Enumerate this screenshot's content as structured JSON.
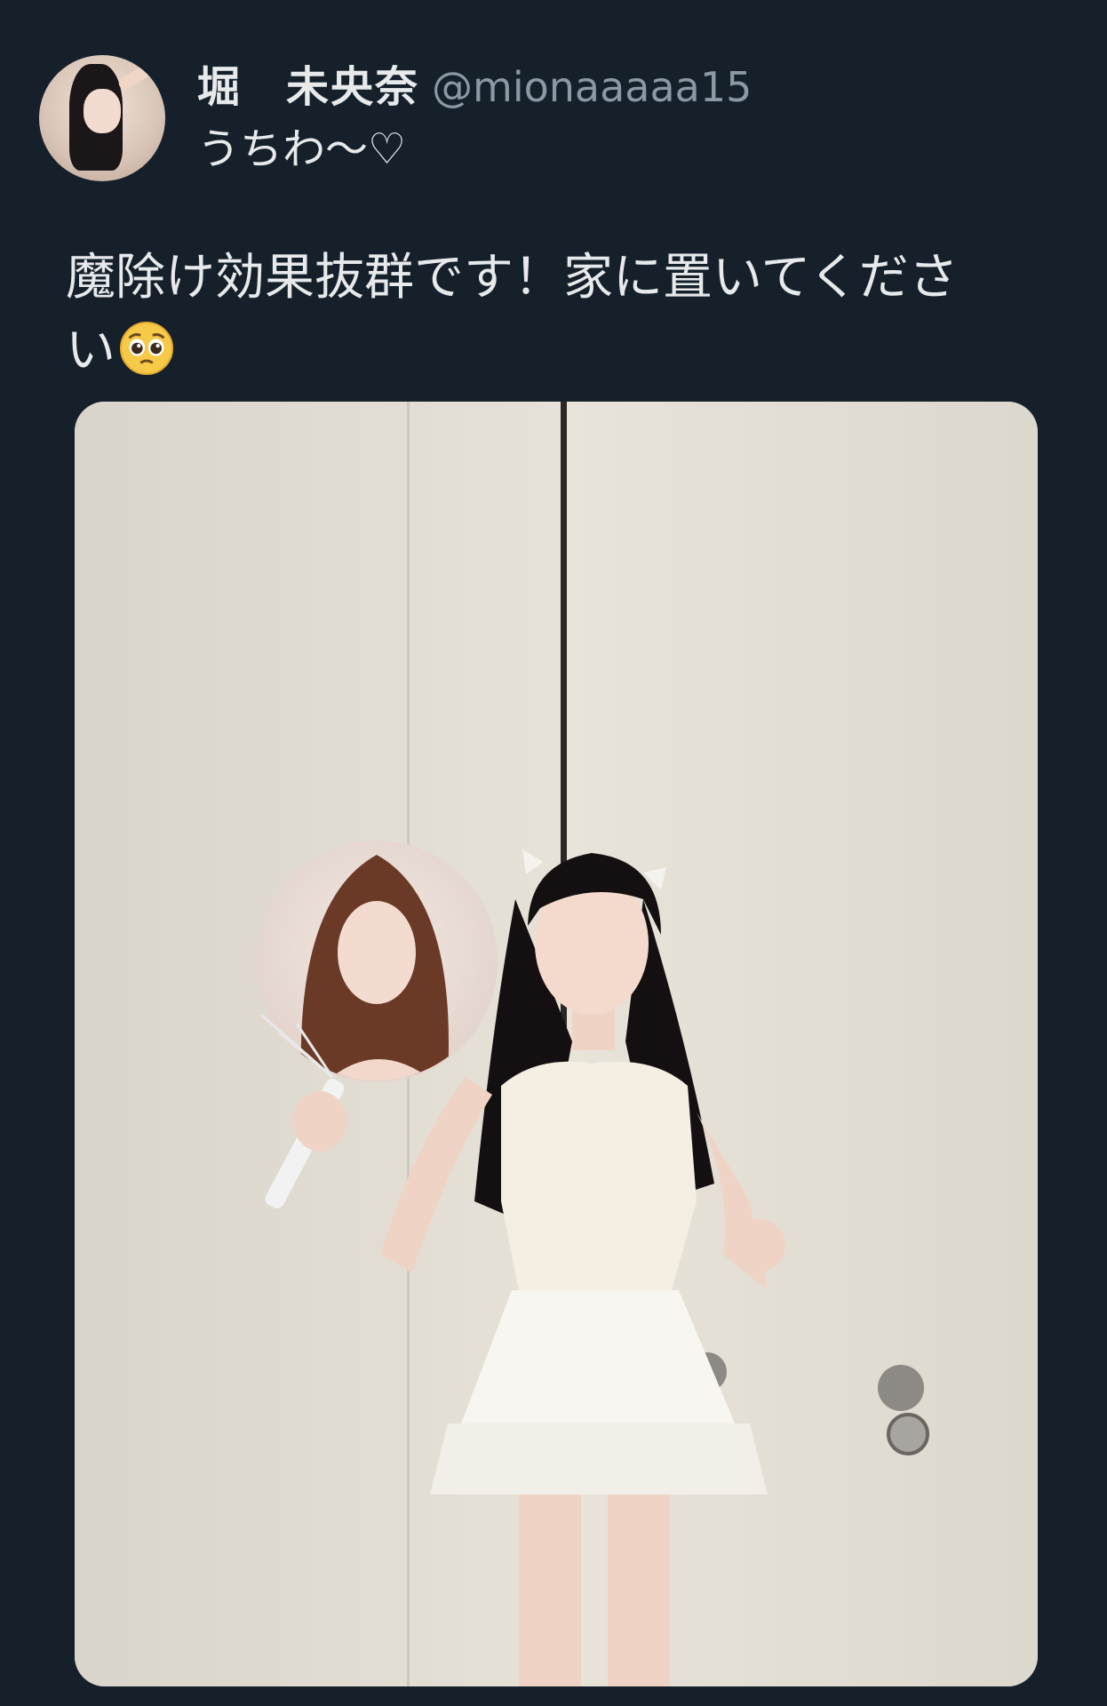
{
  "tweet": {
    "display_name": "堀　未央奈",
    "handle": "@mionaaaaa15",
    "subtitle": "うちわ〜♡",
    "body_line_1": "魔除け効果抜群です！家に置いてくださ",
    "body_line_2": "い",
    "emoji_name": "pleading-face-emoji",
    "media_name": "photo-woman-with-uchiwa-fan"
  },
  "colors": {
    "background": "#15202b",
    "text": "#e7e9ea",
    "handle": "#8b98a5"
  }
}
